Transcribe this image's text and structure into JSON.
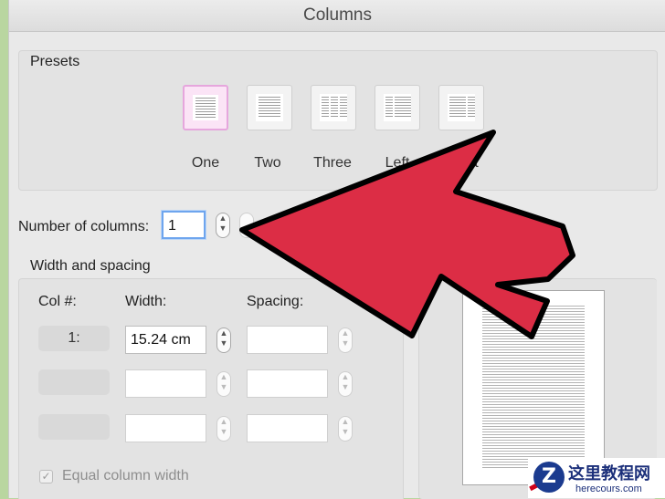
{
  "window": {
    "title": "Columns"
  },
  "presets": {
    "heading": "Presets",
    "items": [
      {
        "label": "One",
        "selected": true
      },
      {
        "label": "Two",
        "selected": false
      },
      {
        "label": "Three",
        "selected": false
      },
      {
        "label": "Left",
        "selected": false
      },
      {
        "label": "Right",
        "selected": false
      }
    ]
  },
  "number_of_columns": {
    "label": "Number of columns:",
    "value": "1"
  },
  "width_spacing": {
    "heading": "Width and spacing",
    "col_header": "Col #:",
    "width_header": "Width:",
    "spacing_header": "Spacing:",
    "rows": [
      {
        "col": "1:",
        "width": "15.24 cm",
        "spacing": ""
      },
      {
        "col": "",
        "width": "",
        "spacing": ""
      },
      {
        "col": "",
        "width": "",
        "spacing": ""
      }
    ]
  },
  "equal_column_width": {
    "label": "Equal column width",
    "checked": true
  },
  "annotation": {
    "arrow_color": "#dc2d45"
  },
  "watermark": {
    "title": "这里教程网",
    "url": "herecours.com",
    "logo_letter": "Z"
  }
}
